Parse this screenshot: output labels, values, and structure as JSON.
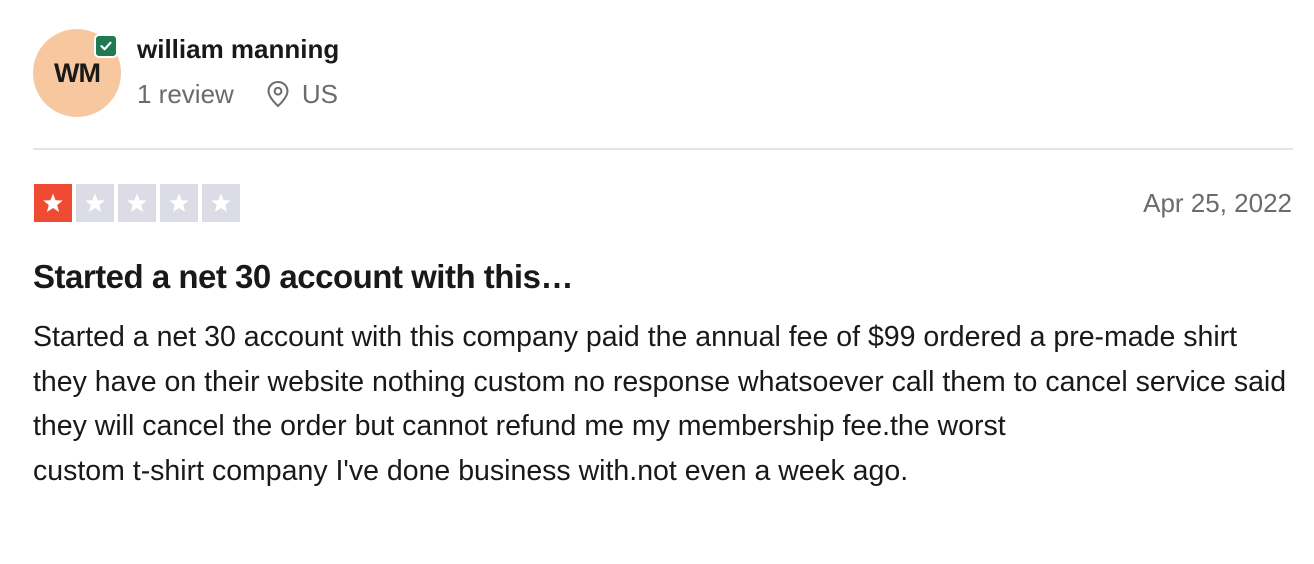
{
  "reviewer": {
    "initials": "WM",
    "name": "william manning",
    "review_count": "1 review",
    "location": "US",
    "avatar_color": "#f7c8a0",
    "verified_icon": "checkmark-badge-icon"
  },
  "review": {
    "rating": 1,
    "max_rating": 5,
    "active_star_color": "#ef4a32",
    "inactive_star_color": "#dcdce6",
    "date": "Apr 25, 2022",
    "title": "Started a net 30 account with this…",
    "body_line1": "Started a net 30 account with this company paid the annual fee of $99 ordered a pre-made shirt they have on their website nothing custom no response whatsoever call them to cancel service said they will cancel the order but cannot refund me my membership fee.the worst",
    "body_line2": "custom t-shirt company I've done business with.not even a week ago."
  }
}
